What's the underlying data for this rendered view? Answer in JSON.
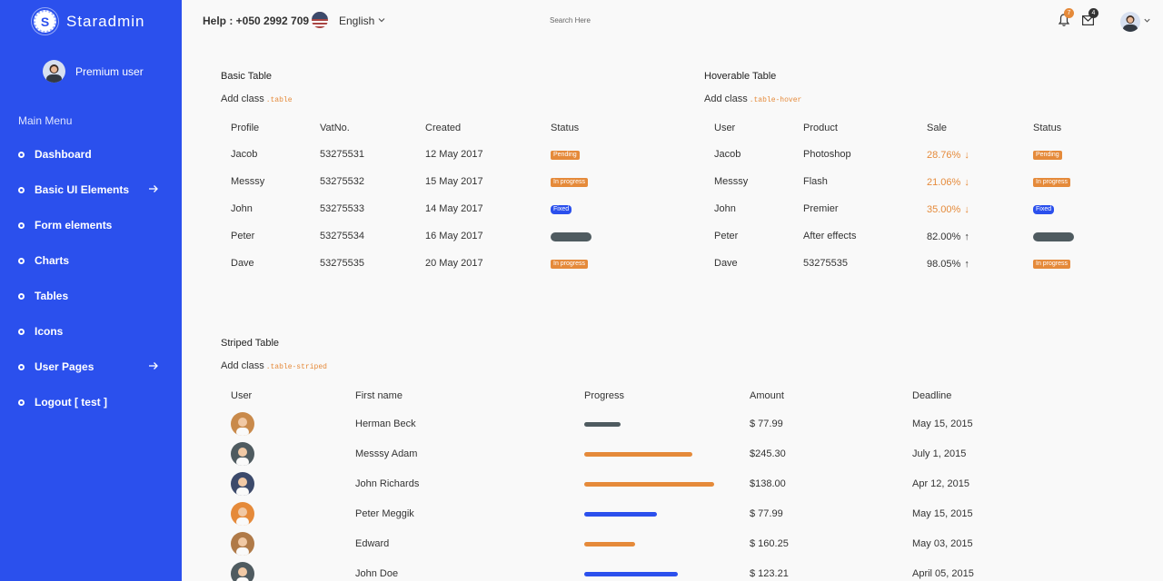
{
  "brand": {
    "initial": "S",
    "name": "Staradmin"
  },
  "profile": {
    "name": "Premium user"
  },
  "sidebar": {
    "section_title": "Main Menu",
    "items": [
      {
        "label": "Dashboard",
        "has_arrow": false
      },
      {
        "label": "Basic UI Elements",
        "has_arrow": true
      },
      {
        "label": "Form elements",
        "has_arrow": false
      },
      {
        "label": "Charts",
        "has_arrow": false
      },
      {
        "label": "Tables",
        "has_arrow": false
      },
      {
        "label": "Icons",
        "has_arrow": false
      },
      {
        "label": "User Pages",
        "has_arrow": true
      },
      {
        "label": "Logout [ test ]",
        "has_arrow": false
      }
    ]
  },
  "topbar": {
    "help": "Help : +050 2992 709",
    "language": "English",
    "search_placeholder": "Search Here",
    "notification_count": "7",
    "message_count": "4"
  },
  "basic_table": {
    "title": "Basic Table",
    "add_class_label": "Add class",
    "class_code": ".table",
    "headers": [
      "Profile",
      "VatNo.",
      "Created",
      "Status"
    ],
    "rows": [
      {
        "profile": "Jacob",
        "vat": "53275531",
        "created": "12 May 2017",
        "status": "Pending",
        "status_type": "warning"
      },
      {
        "profile": "Messsy",
        "vat": "53275532",
        "created": "15 May 2017",
        "status": "In progress",
        "status_type": "warning"
      },
      {
        "profile": "John",
        "vat": "53275533",
        "created": "14 May 2017",
        "status": "Fixed",
        "status_type": "primary"
      },
      {
        "profile": "Peter",
        "vat": "53275534",
        "created": "16 May 2017",
        "status": "",
        "status_type": "dark"
      },
      {
        "profile": "Dave",
        "vat": "53275535",
        "created": "20 May 2017",
        "status": "In progress",
        "status_type": "warning"
      }
    ]
  },
  "hoverable_table": {
    "title": "Hoverable Table",
    "add_class_label": "Add class",
    "class_code": ".table-hover",
    "headers": [
      "User",
      "Product",
      "Sale",
      "Status"
    ],
    "rows": [
      {
        "user": "Jacob",
        "product": "Photoshop",
        "sale": "28.76%",
        "trend": "down",
        "status": "Pending",
        "status_type": "warning"
      },
      {
        "user": "Messsy",
        "product": "Flash",
        "sale": "21.06%",
        "trend": "down",
        "status": "In progress",
        "status_type": "warning"
      },
      {
        "user": "John",
        "product": "Premier",
        "sale": "35.00%",
        "trend": "down",
        "status": "Fixed",
        "status_type": "primary"
      },
      {
        "user": "Peter",
        "product": "After effects",
        "sale": "82.00%",
        "trend": "up",
        "status": "",
        "status_type": "dark"
      },
      {
        "user": "Dave",
        "product": "53275535",
        "sale": "98.05%",
        "trend": "up",
        "status": "In progress",
        "status_type": "warning"
      }
    ]
  },
  "striped_table": {
    "title": "Striped Table",
    "add_class_label": "Add class",
    "class_code": ".table-striped",
    "headers": [
      "User",
      "First name",
      "Progress",
      "Amount",
      "Deadline"
    ],
    "rows": [
      {
        "first_name": "Herman Beck",
        "progress": 0.28,
        "progress_color": "#4f5b60",
        "amount": "$ 77.99",
        "deadline": "May 15, 2015",
        "avatar_bg": "#c98a4b"
      },
      {
        "first_name": "Messsy Adam",
        "progress": 0.83,
        "progress_color": "#e58a3a",
        "amount": "$245.30",
        "deadline": "July 1, 2015",
        "avatar_bg": "#4f5b60"
      },
      {
        "first_name": "John Richards",
        "progress": 1.0,
        "progress_color": "#e58a3a",
        "amount": "$138.00",
        "deadline": "Apr 12, 2015",
        "avatar_bg": "#3c4a6b"
      },
      {
        "first_name": "Peter Meggik",
        "progress": 0.56,
        "progress_color": "#2b50ed",
        "amount": "$ 77.99",
        "deadline": "May 15, 2015",
        "avatar_bg": "#e58a3a"
      },
      {
        "first_name": "Edward",
        "progress": 0.39,
        "progress_color": "#e58a3a",
        "amount": "$ 160.25",
        "deadline": "May 03, 2015",
        "avatar_bg": "#b07a48"
      },
      {
        "first_name": "John Doe",
        "progress": 0.72,
        "progress_color": "#2b50ed",
        "amount": "$ 123.21",
        "deadline": "April 05, 2015",
        "avatar_bg": "#4f5b60"
      }
    ]
  },
  "colors": {
    "sidebar": "#2b50ed",
    "warning": "#e58a3a",
    "primary": "#2b50ed",
    "dark": "#4f5b60"
  }
}
